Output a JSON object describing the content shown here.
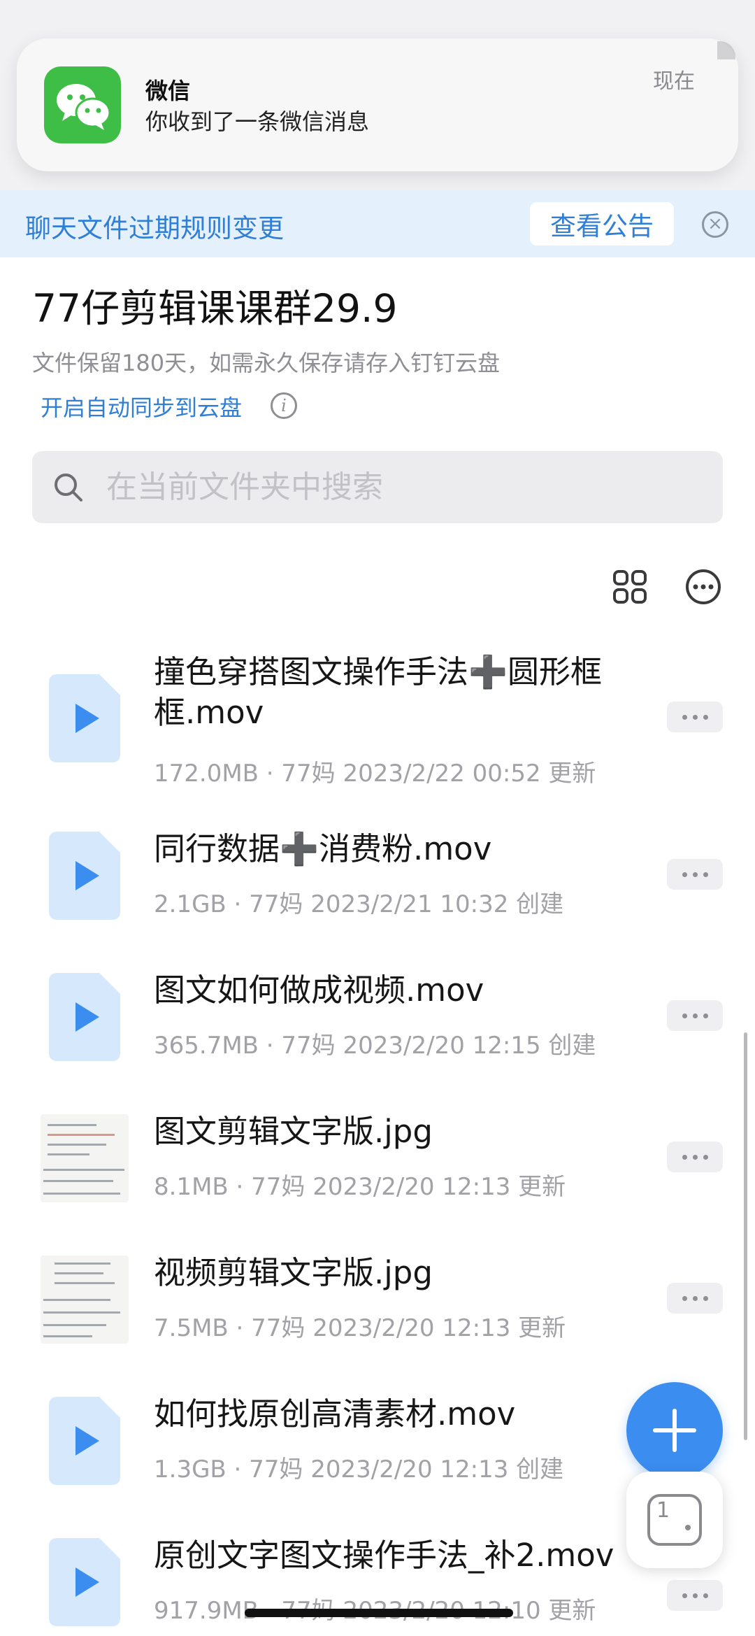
{
  "notification": {
    "app_name": "微信",
    "message": "你收到了一条微信消息",
    "time": "现在",
    "icon": "wechat-icon",
    "icon_color": "#3fbe47"
  },
  "banner": {
    "text": "聊天文件过期规则变更",
    "button_label": "查看公告",
    "close_icon": "close-circle-icon"
  },
  "header": {
    "title": "77仔剪辑课课群29.9",
    "retention_note": "文件保留180天，如需永久保存请存入钉钉云盘",
    "sync_link": "开启自动同步到云盘",
    "info_icon": "info-icon"
  },
  "search": {
    "placeholder": "在当前文件夹中搜索",
    "value": ""
  },
  "toolbar": {
    "view_icon": "grid-view-icon",
    "more_icon": "more-circle-icon"
  },
  "files": [
    {
      "name": "撞色穿搭图文操作手法➕圆形框框.mov",
      "meta": "172.0MB · 77妈 2023/2/22 00:52 更新",
      "type": "video"
    },
    {
      "name": "同行数据➕消费粉.mov",
      "meta": "2.1GB · 77妈 2023/2/21 10:32 创建",
      "type": "video"
    },
    {
      "name": "图文如何做成视频.mov",
      "meta": "365.7MB · 77妈 2023/2/20 12:15 创建",
      "type": "video"
    },
    {
      "name": "图文剪辑文字版.jpg",
      "meta": "8.1MB · 77妈 2023/2/20 12:13 更新",
      "type": "image"
    },
    {
      "name": "视频剪辑文字版.jpg",
      "meta": "7.5MB · 77妈 2023/2/20 12:13 更新",
      "type": "image"
    },
    {
      "name": "如何找原创高清素材.mov",
      "meta": "1.3GB · 77妈 2023/2/20 12:13 创建",
      "type": "video"
    },
    {
      "name": "原创文字图文操作手法_补2.mov",
      "meta": "917.9MB · 77妈 2023/2/20 12:10 更新",
      "type": "video"
    }
  ],
  "fab": {
    "icon": "plus-icon",
    "color": "#3b8ef0"
  },
  "floating_window": {
    "count": "1"
  },
  "colors": {
    "accent": "#2f7fd6",
    "banner_bg": "#e4f1fd"
  }
}
